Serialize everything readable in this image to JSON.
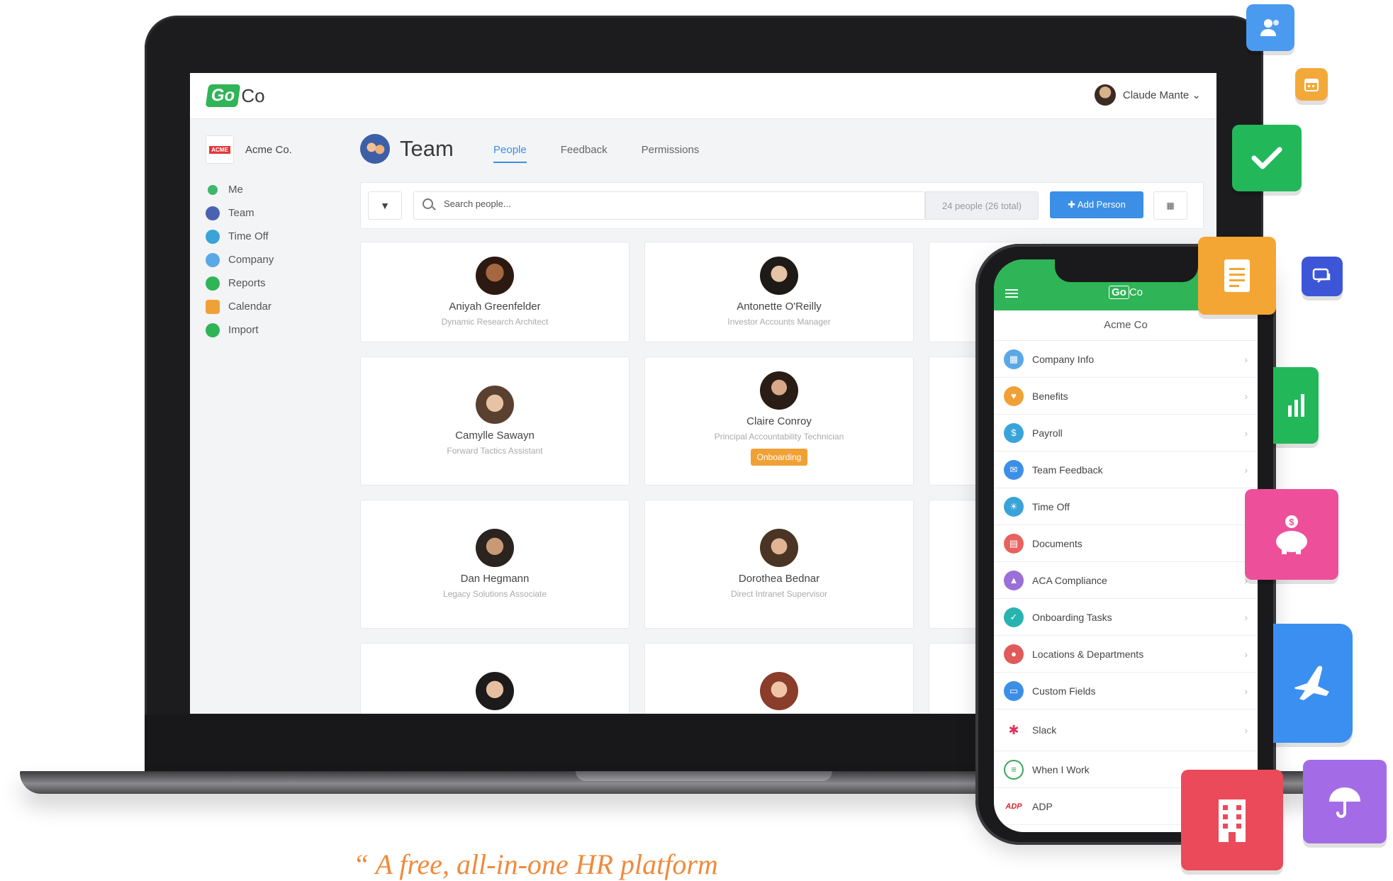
{
  "app": {
    "logo_go": "Go",
    "logo_co": "Co",
    "user_name": "Claude Mante ⌄"
  },
  "sidebar": {
    "company": "Acme Co.",
    "acme_badge": "ACME",
    "items": [
      {
        "label": "Me",
        "color": "#3fb66b"
      },
      {
        "label": "Team",
        "color": "#4a63b0"
      },
      {
        "label": "Time Off",
        "color": "#3aa3d8"
      },
      {
        "label": "Company",
        "color": "#5aa8e6"
      },
      {
        "label": "Reports",
        "color": "#2fb457"
      },
      {
        "label": "Calendar",
        "color": "#f0a136"
      },
      {
        "label": "Import",
        "color": "#2fb457"
      }
    ]
  },
  "page": {
    "title": "Team",
    "tabs": [
      {
        "label": "People",
        "active": true
      },
      {
        "label": "Feedback",
        "active": false
      },
      {
        "label": "Permissions",
        "active": false
      }
    ]
  },
  "toolbar": {
    "search_placeholder": "Search people...",
    "count": "24 people (26 total)",
    "add_label": "✚  Add Person"
  },
  "people": [
    {
      "name": "Aniyah Greenfelder",
      "role": "Dynamic Research Architect"
    },
    {
      "name": "Antonette O'Reilly",
      "role": "Investor Accounts Manager"
    },
    {
      "name": "Camylle Sawayn",
      "role": "Forward Tactics Assistant"
    },
    {
      "name": "Claire Conroy",
      "role": "Principal Accountability Technician",
      "badge": "Onboarding"
    },
    {
      "name": "Dan Hegmann",
      "role": "Legacy Solutions Associate"
    },
    {
      "name": "Dorothea Bednar",
      "role": "Direct Intranet Supervisor"
    }
  ],
  "phone": {
    "logo": "Co",
    "logo_mark": "Go",
    "company": "Acme Co",
    "items": [
      {
        "label": "Company Info",
        "color": "#5aa8e6"
      },
      {
        "label": "Benefits",
        "color": "#f0a136"
      },
      {
        "label": "Payroll",
        "color": "#3aa3d8"
      },
      {
        "label": "Team Feedback",
        "color": "#3c8fe6"
      },
      {
        "label": "Time Off",
        "color": "#3aa3d8"
      },
      {
        "label": "Documents",
        "color": "#e8625f"
      },
      {
        "label": "ACA Compliance",
        "color": "#9a6fd8"
      },
      {
        "label": "Onboarding Tasks",
        "color": "#29b3b0"
      },
      {
        "label": "Locations & Departments",
        "color": "#e05a5a"
      },
      {
        "label": "Custom Fields",
        "color": "#3c8fe6"
      },
      {
        "label": "Slack",
        "color": "#ffffff"
      },
      {
        "label": "When I Work",
        "color": "#ffffff"
      },
      {
        "label": "ADP",
        "color": "#ffffff"
      }
    ],
    "chevron": "›"
  },
  "tagline": "“  A free, all-in-one HR platform"
}
